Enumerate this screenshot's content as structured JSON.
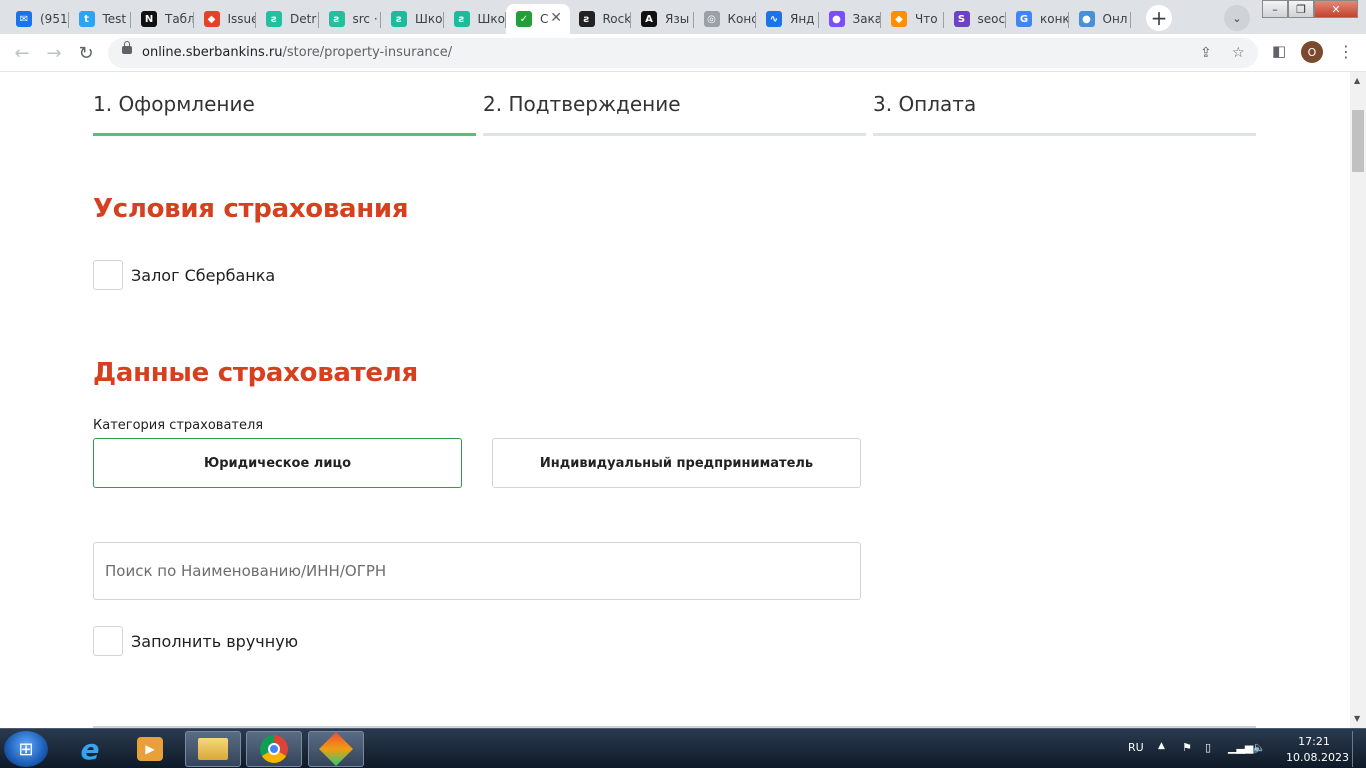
{
  "browser": {
    "tabs": [
      {
        "label": "(951",
        "fav_color": "#1a73e8",
        "fav_glyph": "✉"
      },
      {
        "label": "Test",
        "fav_color": "#2aa4f4",
        "fav_glyph": "t"
      },
      {
        "label": "Табл",
        "fav_color": "#111111",
        "fav_glyph": "N"
      },
      {
        "label": "Issue",
        "fav_color": "#e24329",
        "fav_glyph": "◆"
      },
      {
        "label": "Detr",
        "fav_color": "#21c1a0",
        "fav_glyph": "ƨ"
      },
      {
        "label": "src ·",
        "fav_color": "#21c1a0",
        "fav_glyph": "ƨ"
      },
      {
        "label": "Шко",
        "fav_color": "#1abc9c",
        "fav_glyph": "ƨ"
      },
      {
        "label": "Шко",
        "fav_color": "#1abc9c",
        "fav_glyph": "ƨ"
      },
      {
        "label": "С",
        "fav_color": "#21a038",
        "fav_glyph": "✓"
      },
      {
        "label": "Rock",
        "fav_color": "#222222",
        "fav_glyph": "ƨ"
      },
      {
        "label": "Язы",
        "fav_color": "#111111",
        "fav_glyph": "A"
      },
      {
        "label": "Конс",
        "fav_color": "#9aa0a6",
        "fav_glyph": "◎"
      },
      {
        "label": "Янд",
        "fav_color": "#1a73e8",
        "fav_glyph": "∿"
      },
      {
        "label": "Зака",
        "fav_color": "#7c4dff",
        "fav_glyph": "●"
      },
      {
        "label": "Что",
        "fav_color": "#ff8f00",
        "fav_glyph": "◆"
      },
      {
        "label": "seoc",
        "fav_color": "#6f42c1",
        "fav_glyph": "S"
      },
      {
        "label": "конк",
        "fav_color": "#4285f4",
        "fav_glyph": "G"
      },
      {
        "label": "Онл",
        "fav_color": "#4a90d9",
        "fav_glyph": "●"
      }
    ],
    "active_tab_index": 8,
    "newtab_glyph": "+",
    "tabsearch_glyph": "⌄",
    "url_host": "online.sberbankins.ru",
    "url_path": "/store/property-insurance/",
    "profile_initial": "О"
  },
  "steps": [
    {
      "label": "1. Оформление",
      "active": true
    },
    {
      "label": "2. Подтверждение",
      "active": false
    },
    {
      "label": "3. Оплата",
      "active": false
    }
  ],
  "conditions": {
    "title": "Условия страхования",
    "pledge_label": "Залог Сбербанка"
  },
  "insurer": {
    "title": "Данные страхователя",
    "category_label": "Категория страхователя",
    "options": [
      "Юридическое лицо",
      "Индивидуальный предприниматель"
    ],
    "selected": 0,
    "search_placeholder": "Поиск по Наименованию/ИНН/ОГРН",
    "search_value": "",
    "manual_label": "Заполнить вручную"
  },
  "taskbar": {
    "lang": "RU",
    "time": "17:21",
    "date": "10.08.2023"
  },
  "colors": {
    "accent_green": "#4cc77a",
    "heading_red": "#d7401e",
    "selected_border": "#2e9b4e"
  }
}
